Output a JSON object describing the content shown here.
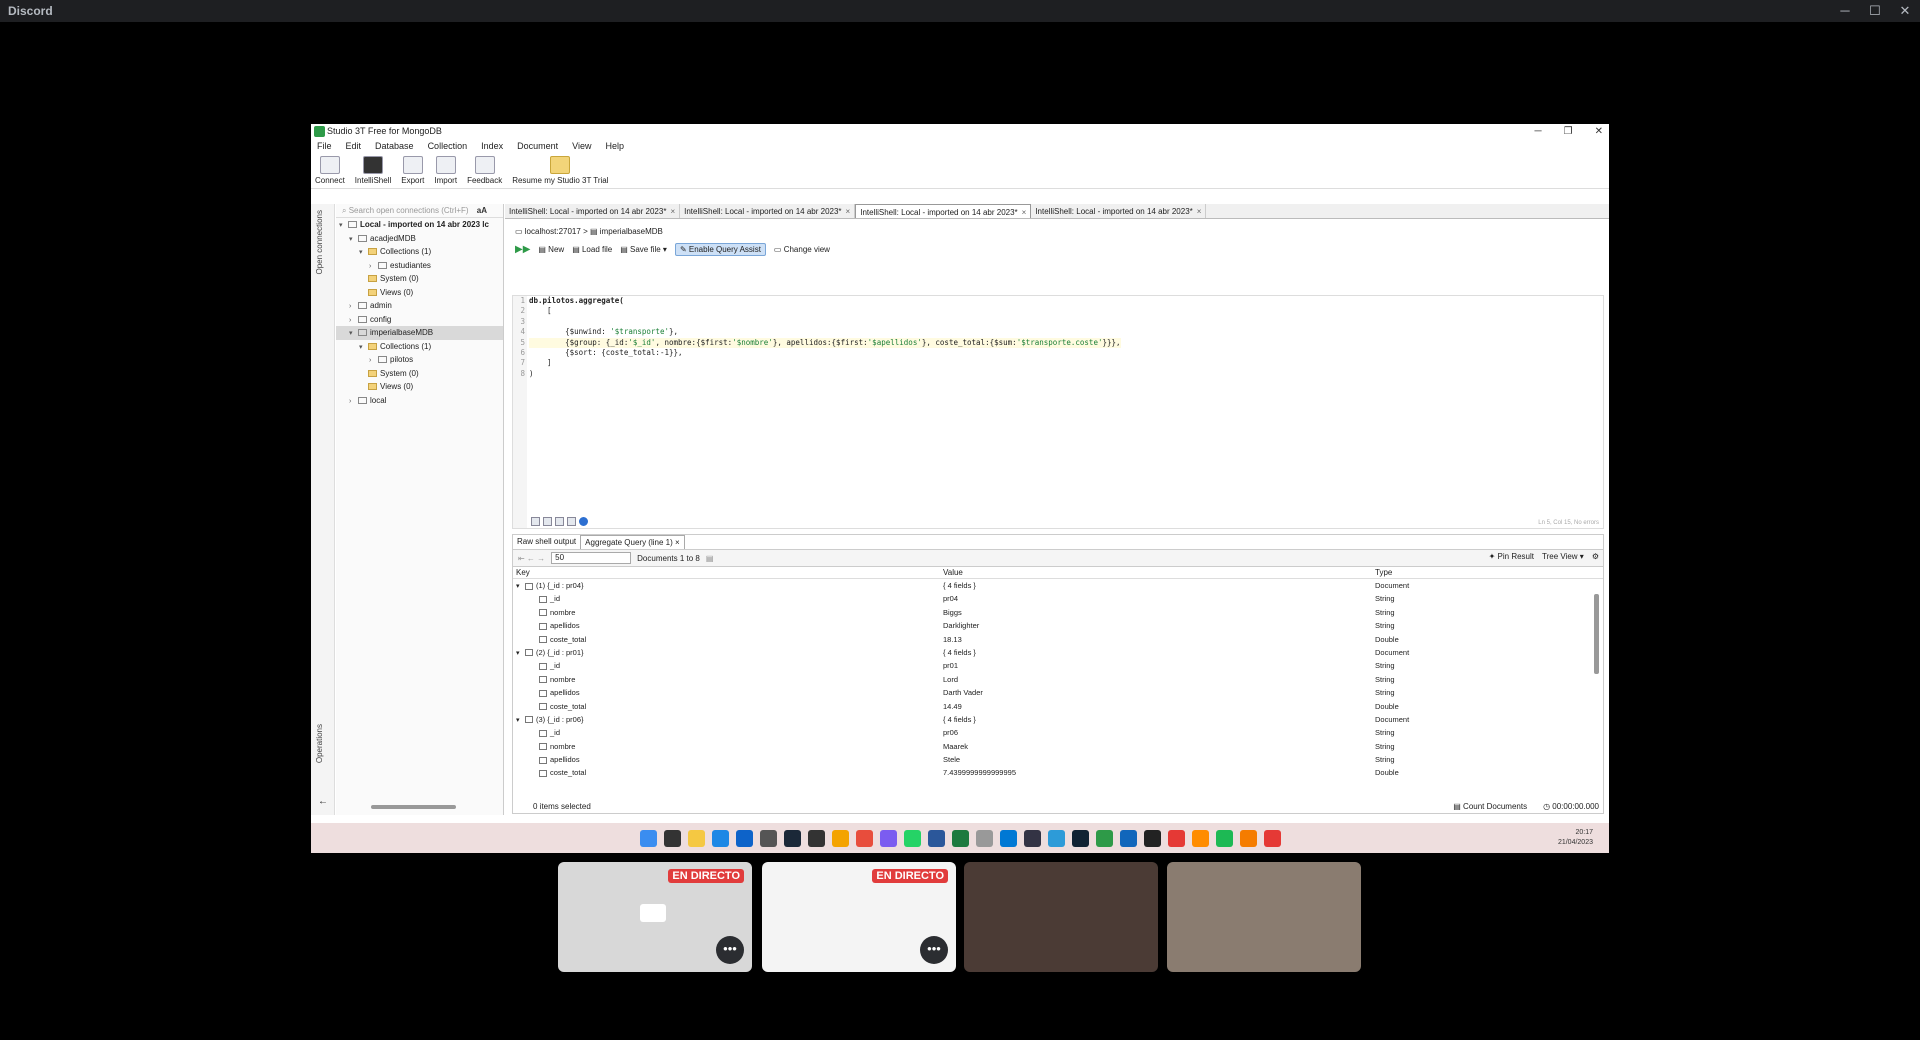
{
  "discord": {
    "title": "Discord",
    "controls": [
      "─",
      "☐",
      "✕"
    ]
  },
  "studio": {
    "title": "Studio 3T Free for MongoDB",
    "window_controls": [
      "─",
      "❐",
      "✕"
    ],
    "menu": [
      "File",
      "Edit",
      "Database",
      "Collection",
      "Index",
      "Document",
      "View",
      "Help"
    ],
    "toolbar": [
      {
        "label": "Connect",
        "style": ""
      },
      {
        "label": "IntelliShell",
        "style": "dark"
      },
      {
        "label": "Export",
        "style": ""
      },
      {
        "label": "Import",
        "style": ""
      },
      {
        "label": "Feedback",
        "style": ""
      },
      {
        "label": "Resume my Studio 3T Trial",
        "style": "gold"
      }
    ],
    "side_tabs": {
      "top": "Open connections",
      "bottom": "Operations",
      "back": "←"
    },
    "tree_search": "Search open connections (Ctrl+F)",
    "tree_search_case": "aA",
    "tree": [
      {
        "d": 0,
        "t": "v",
        "i": "db",
        "l": "Local - imported on 14 abr 2023 lc",
        "b": true
      },
      {
        "d": 1,
        "t": "v",
        "i": "db",
        "l": "acadjedMDB"
      },
      {
        "d": 2,
        "t": "v",
        "i": "fold",
        "l": "Collections (1)"
      },
      {
        "d": 3,
        "t": ">",
        "i": "coll",
        "l": "estudiantes"
      },
      {
        "d": 2,
        "t": "",
        "i": "fold",
        "l": "System (0)"
      },
      {
        "d": 2,
        "t": "",
        "i": "fold",
        "l": "Views (0)"
      },
      {
        "d": 1,
        "t": ">",
        "i": "db",
        "l": "admin"
      },
      {
        "d": 1,
        "t": ">",
        "i": "db",
        "l": "config"
      },
      {
        "d": 1,
        "t": "v",
        "i": "db",
        "l": "imperialbaseMDB",
        "sel": true
      },
      {
        "d": 2,
        "t": "v",
        "i": "fold",
        "l": "Collections (1)"
      },
      {
        "d": 3,
        "t": ">",
        "i": "coll",
        "l": "pilotos"
      },
      {
        "d": 2,
        "t": "",
        "i": "fold",
        "l": "System (0)"
      },
      {
        "d": 2,
        "t": "",
        "i": "fold",
        "l": "Views (0)"
      },
      {
        "d": 1,
        "t": ">",
        "i": "db",
        "l": "local"
      }
    ],
    "tabs": [
      {
        "label": "IntelliShell: Local - imported on 14 abr 2023*",
        "close": "×"
      },
      {
        "label": "IntelliShell: Local - imported on 14 abr 2023*",
        "close": "×"
      },
      {
        "label": "IntelliShell: Local - imported on 14 abr 2023*",
        "close": "×",
        "active": true
      },
      {
        "label": "IntelliShell: Local - imported on 14 abr 2023*",
        "close": "×"
      }
    ],
    "breadcrumb": {
      "host": "localhost:27017",
      "sep": ">",
      "db": "imperialbaseMDB"
    },
    "editor_tools": {
      "new": "New",
      "load": "Load file",
      "save": "Save file",
      "query_assist": "Enable Query Assist",
      "change_view": "Change view"
    },
    "code": [
      [
        {
          "c": "kw",
          "s": "db.pilotos.aggregate("
        }
      ],
      [
        {
          "s": "    ["
        }
      ],
      [
        {
          "s": ""
        }
      ],
      [
        {
          "s": "        {$unwind: "
        },
        {
          "c": "str",
          "s": "'$transporte'"
        },
        {
          "s": "},"
        }
      ],
      [
        {
          "s": "        {$group: {_id:"
        },
        {
          "c": "str",
          "s": "'$_id'"
        },
        {
          "s": ", nombre:{$first:"
        },
        {
          "c": "str",
          "s": "'$nombre'"
        },
        {
          "s": "}, apellidos:{$first:"
        },
        {
          "c": "str",
          "s": "'$apellidos'"
        },
        {
          "s": "}, coste_total:{$sum:"
        },
        {
          "c": "str",
          "s": "'$transporte.coste'"
        },
        {
          "s": "}}},"
        }
      ],
      [
        {
          "s": "        {$sort: {coste_total:-1}},"
        }
      ],
      [
        {
          "s": "    ]"
        }
      ],
      [
        {
          "s": ")"
        }
      ]
    ],
    "highlight_line": 5,
    "cursor_status": "Ln 5, Col 15, No errors",
    "results": {
      "tabs": [
        "Raw shell output",
        "Aggregate Query (line 1)"
      ],
      "page_size": "50",
      "documents": "Documents 1 to 8",
      "pin": "Pin Result",
      "view": "Tree View",
      "columns": [
        "Key",
        "Value",
        "Type"
      ],
      "rows": [
        {
          "exp": "v",
          "ind": 0,
          "k": "(1) {_id : pr04}",
          "v": "{ 4 fields }",
          "t": "Document"
        },
        {
          "ind": 1,
          "k": "_id",
          "v": "pr04",
          "t": "String"
        },
        {
          "ind": 1,
          "k": "nombre",
          "v": "Biggs",
          "t": "String"
        },
        {
          "ind": 1,
          "k": "apellidos",
          "v": "Darklighter",
          "t": "String"
        },
        {
          "ind": 1,
          "k": "coste_total",
          "v": "18.13",
          "t": "Double"
        },
        {
          "exp": "v",
          "ind": 0,
          "k": "(2) {_id : pr01}",
          "v": "{ 4 fields }",
          "t": "Document"
        },
        {
          "ind": 1,
          "k": "_id",
          "v": "pr01",
          "t": "String"
        },
        {
          "ind": 1,
          "k": "nombre",
          "v": "Lord",
          "t": "String"
        },
        {
          "ind": 1,
          "k": "apellidos",
          "v": "Darth Vader",
          "t": "String"
        },
        {
          "ind": 1,
          "k": "coste_total",
          "v": "14.49",
          "t": "Double"
        },
        {
          "exp": "v",
          "ind": 0,
          "k": "(3) {_id : pr06}",
          "v": "{ 4 fields }",
          "t": "Document"
        },
        {
          "ind": 1,
          "k": "_id",
          "v": "pr06",
          "t": "String"
        },
        {
          "ind": 1,
          "k": "nombre",
          "v": "Maarek",
          "t": "String"
        },
        {
          "ind": 1,
          "k": "apellidos",
          "v": "Stele",
          "t": "String"
        },
        {
          "ind": 1,
          "k": "coste_total",
          "v": "7.4399999999999995",
          "t": "Double"
        }
      ],
      "selected": "0 items selected",
      "count": "Count Documents",
      "timer": "00:00:00.000"
    }
  },
  "taskbar": {
    "colors": [
      "#3a8df0",
      "#333",
      "#f5c842",
      "#1e88e5",
      "#0d63c9",
      "#555",
      "#1b2838",
      "#333",
      "#f4a300",
      "#e84d3c",
      "#7b5cf0",
      "#25d366",
      "#2b579a",
      "#1d7a3f",
      "#999",
      "#0078d4",
      "#334",
      "#2d9bd8",
      "#123",
      "#2e9a48",
      "#16b",
      "#222",
      "#e53935",
      "#ff8c00",
      "#1db954",
      "#f57c00",
      "#e53935"
    ],
    "time": "20:17",
    "date": "21/04/2023"
  },
  "participants": [
    {
      "live": "EN DIRECTO",
      "more": "•••",
      "bg": "#d8d8d8"
    },
    {
      "live": "EN DIRECTO",
      "more": "•••",
      "bg": "#f4f4f4"
    },
    {
      "bg": "#4b3b35"
    },
    {
      "bg": "#8a7c70"
    }
  ]
}
